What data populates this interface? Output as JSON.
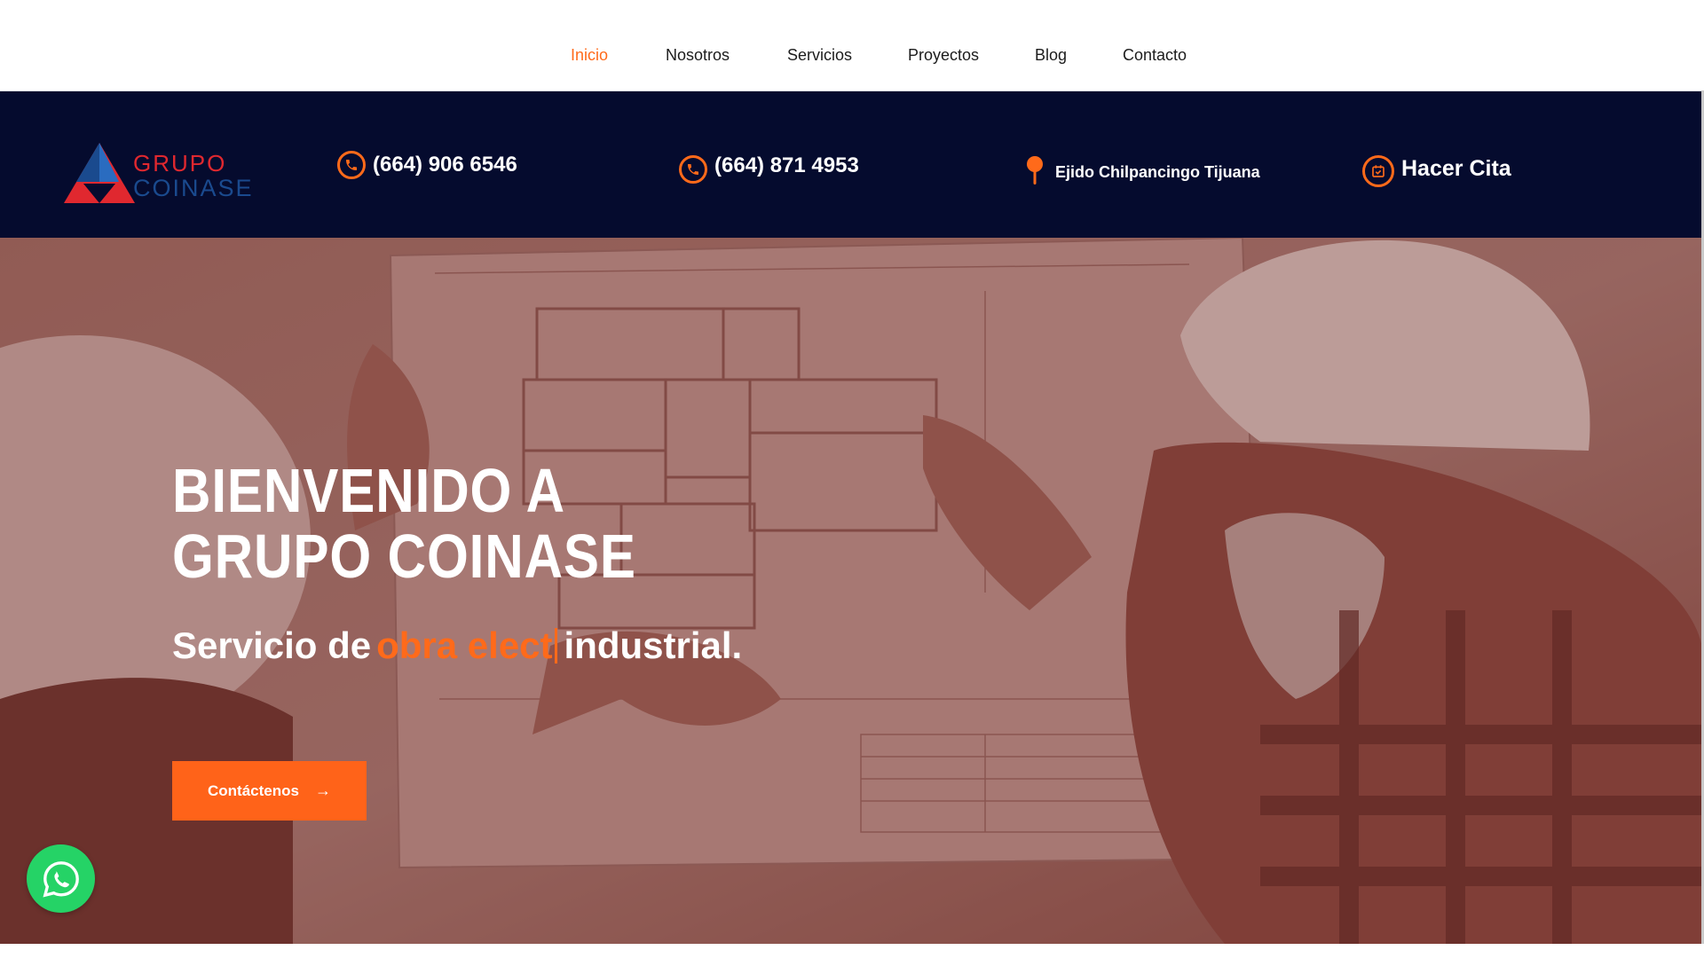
{
  "nav": {
    "items": [
      {
        "label": "Inicio",
        "active": true
      },
      {
        "label": "Nosotros",
        "active": false
      },
      {
        "label": "Servicios",
        "active": false
      },
      {
        "label": "Proyectos",
        "active": false
      },
      {
        "label": "Blog",
        "active": false
      },
      {
        "label": "Contacto",
        "active": false
      }
    ]
  },
  "topbar": {
    "logo": {
      "line1": "GRUPO",
      "line2": "COINASE"
    },
    "phone1": "(664) 906 6546",
    "phone2": "(664) 871 4953",
    "location": "Ejido Chilpancingo Tijuana",
    "appointment": "Hacer Cita",
    "icons": [
      "phone-icon",
      "phone-icon",
      "map-pin-icon",
      "calendar-icon"
    ]
  },
  "hero": {
    "title_line1": "BIENVENIDO A",
    "title_line2": "GRUPO COINASE",
    "subtitle_prefix": "Servicio de",
    "subtitle_highlight": "obra elect",
    "subtitle_suffix": "industrial.",
    "cta_label": "Contáctenos"
  },
  "colors": {
    "accent": "#ff6a1a",
    "navy": "#050b2e",
    "whatsapp": "#25d366",
    "overlay": "#9a6058"
  }
}
